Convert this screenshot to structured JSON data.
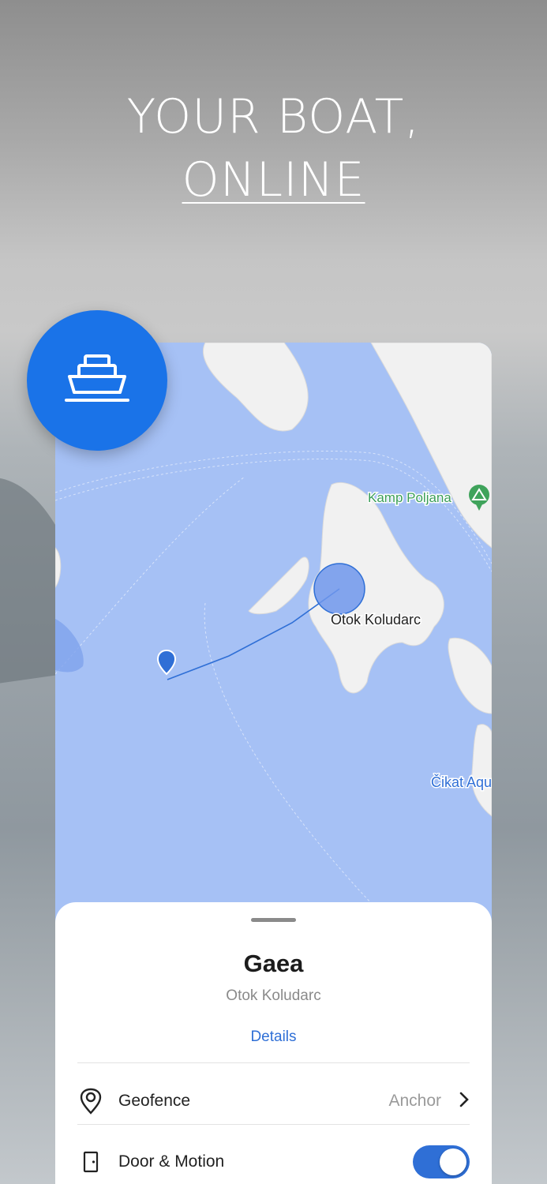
{
  "hero": {
    "line1": "YOUR BOAT,",
    "line2": "ONLINE"
  },
  "badge": {
    "icon": "boat-icon",
    "color": "#1a73e8"
  },
  "map": {
    "labels": {
      "camp": "Kamp Poljana",
      "island": "Otok Koludarc",
      "place": "Čikat Aqu"
    },
    "water_color": "#a6c1f5",
    "accent": "#2f6fd6"
  },
  "sheet": {
    "title": "Gaea",
    "subtitle": "Otok Koludarc",
    "details_link": "Details",
    "rows": [
      {
        "icon": "location-pin-icon",
        "label": "Geofence",
        "value": "Anchor"
      },
      {
        "icon": "door-icon",
        "label": "Door & Motion",
        "toggle_on": true
      }
    ]
  }
}
